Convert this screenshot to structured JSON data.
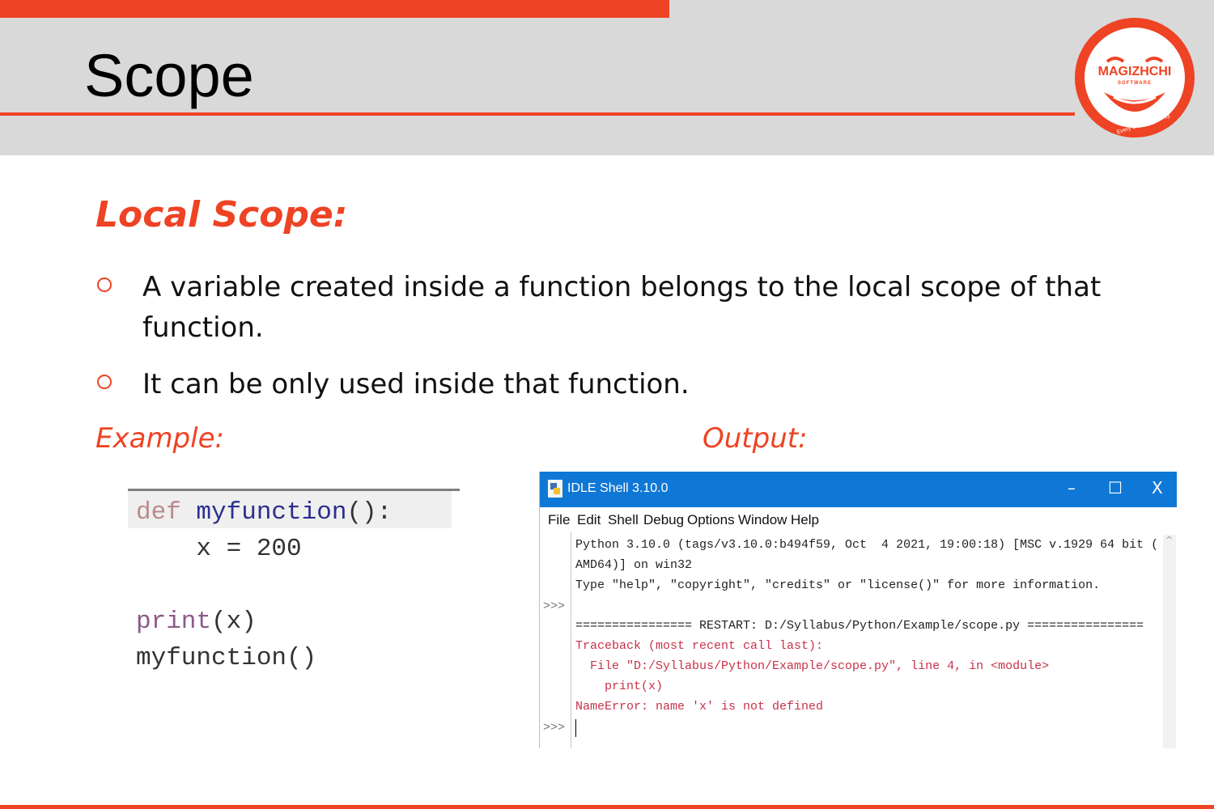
{
  "slide": {
    "title": "Scope",
    "heading": "Local Scope:",
    "bullets": [
      "A variable created inside a function belongs to the local scope of that function.",
      "It can be only used inside that function."
    ],
    "example_label": "Example:",
    "output_label": "Output:"
  },
  "logo": {
    "name": "MAGIZHCHI",
    "sub": "SOFTWARE",
    "tagline": "Every Day Happy Day"
  },
  "code": {
    "line1_kw": "def",
    "line1_fn": " myfunction",
    "line1_rest": "():",
    "line2": "    x = 200",
    "line3_fn": "print",
    "line3_rest": "(x)",
    "line4": "myfunction()"
  },
  "idle": {
    "window_title": "IDLE Shell 3.10.0",
    "controls": [
      "–",
      "☐",
      "X"
    ],
    "menu": [
      "File",
      "Edit",
      "Shell",
      "Debug",
      "Options",
      "Window",
      "Help"
    ],
    "prompt": ">>>",
    "lines": [
      "Python 3.10.0 (tags/v3.10.0:b494f59, Oct  4 2021, 19:00:18) [MSC v.1929 64 bit (",
      "AMD64)] on win32",
      "Type \"help\", \"copyright\", \"credits\" or \"license()\" for more information.",
      "",
      "================ RESTART: D:/Syllabus/Python/Example/scope.py ================",
      "Traceback (most recent call last):",
      "  File \"D:/Syllabus/Python/Example/scope.py\", line 4, in <module>",
      "    print(x)",
      "NameError: name 'x' is not defined"
    ]
  },
  "colors": {
    "accent": "#ee4324",
    "header_band": "#d9d9d9",
    "idle_titlebar": "#0f78d6",
    "error_text": "#c8324a"
  }
}
